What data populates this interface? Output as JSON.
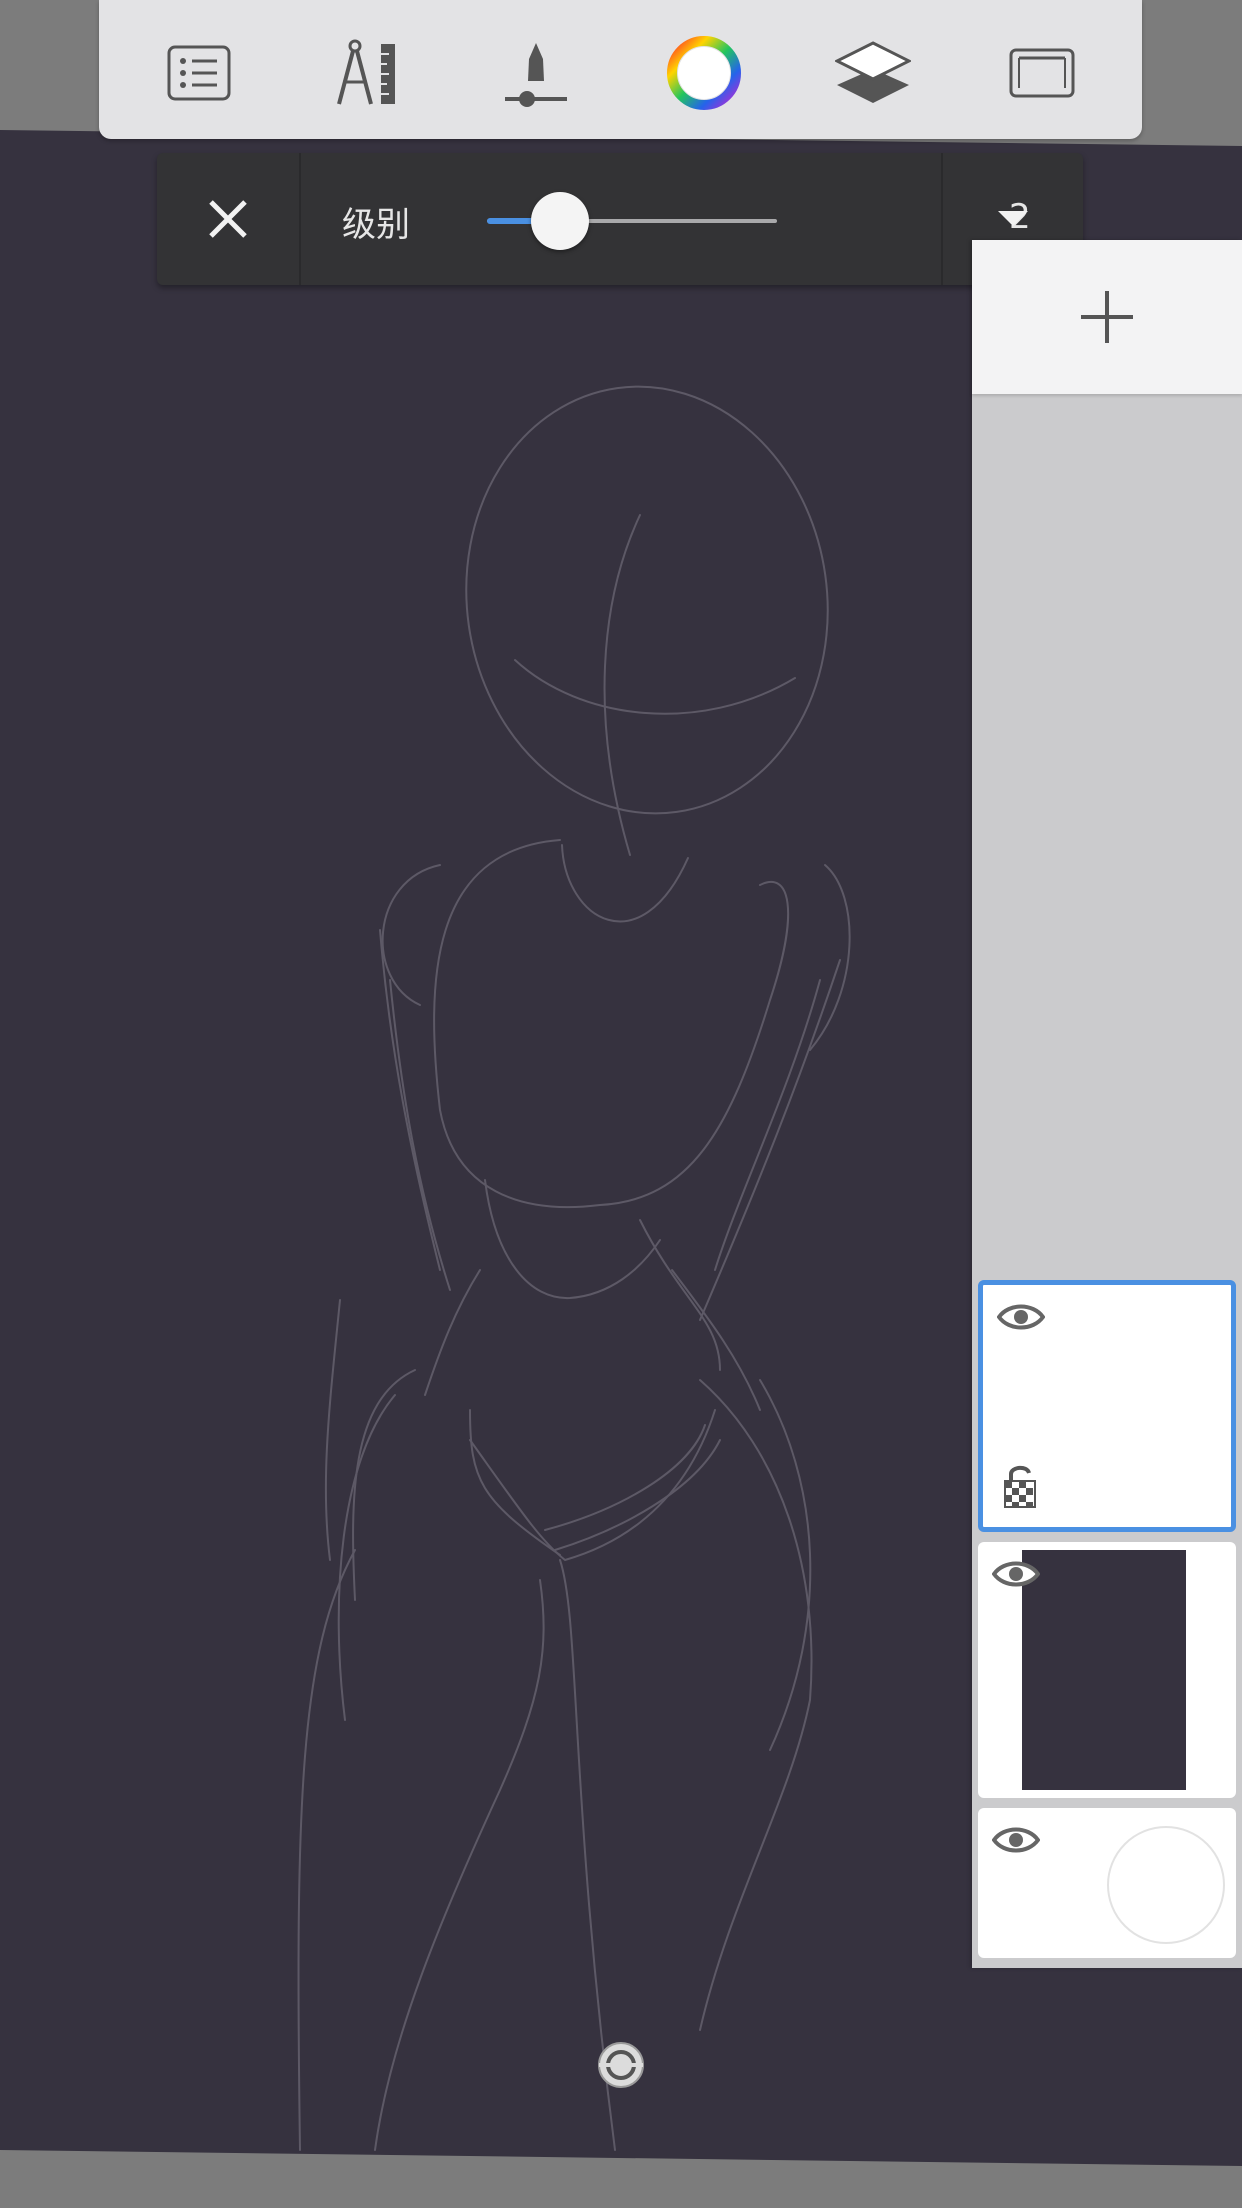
{
  "toolbar": {
    "tools": [
      {
        "name": "list-icon"
      },
      {
        "name": "ruler-compass-icon"
      },
      {
        "name": "brush-size-icon"
      },
      {
        "name": "color-wheel-icon"
      },
      {
        "name": "layers-icon"
      },
      {
        "name": "canvas-frame-icon"
      }
    ]
  },
  "level_bar": {
    "label": "级别",
    "value": "2",
    "slider_fraction": 0.25,
    "close_icon": "close-icon",
    "dropdown_icon": "triangle-down-icon",
    "accent": "#4a90e2"
  },
  "layers": {
    "add_icon": "plus-icon",
    "items": [
      {
        "id": "layer-top",
        "visible": true,
        "locked_alpha": true,
        "active": true
      },
      {
        "id": "layer-dark-fill",
        "visible": true,
        "thumbnail": "dark",
        "active": false
      },
      {
        "id": "layer-background",
        "visible": true,
        "thumbnail": "circle",
        "active": false
      }
    ]
  },
  "colors": {
    "canvas": "#36323f",
    "sketch_stroke": "#5d5966",
    "toolbar": "#e3e3e5",
    "panel": "#333335",
    "active_outline": "#4a90e2"
  }
}
